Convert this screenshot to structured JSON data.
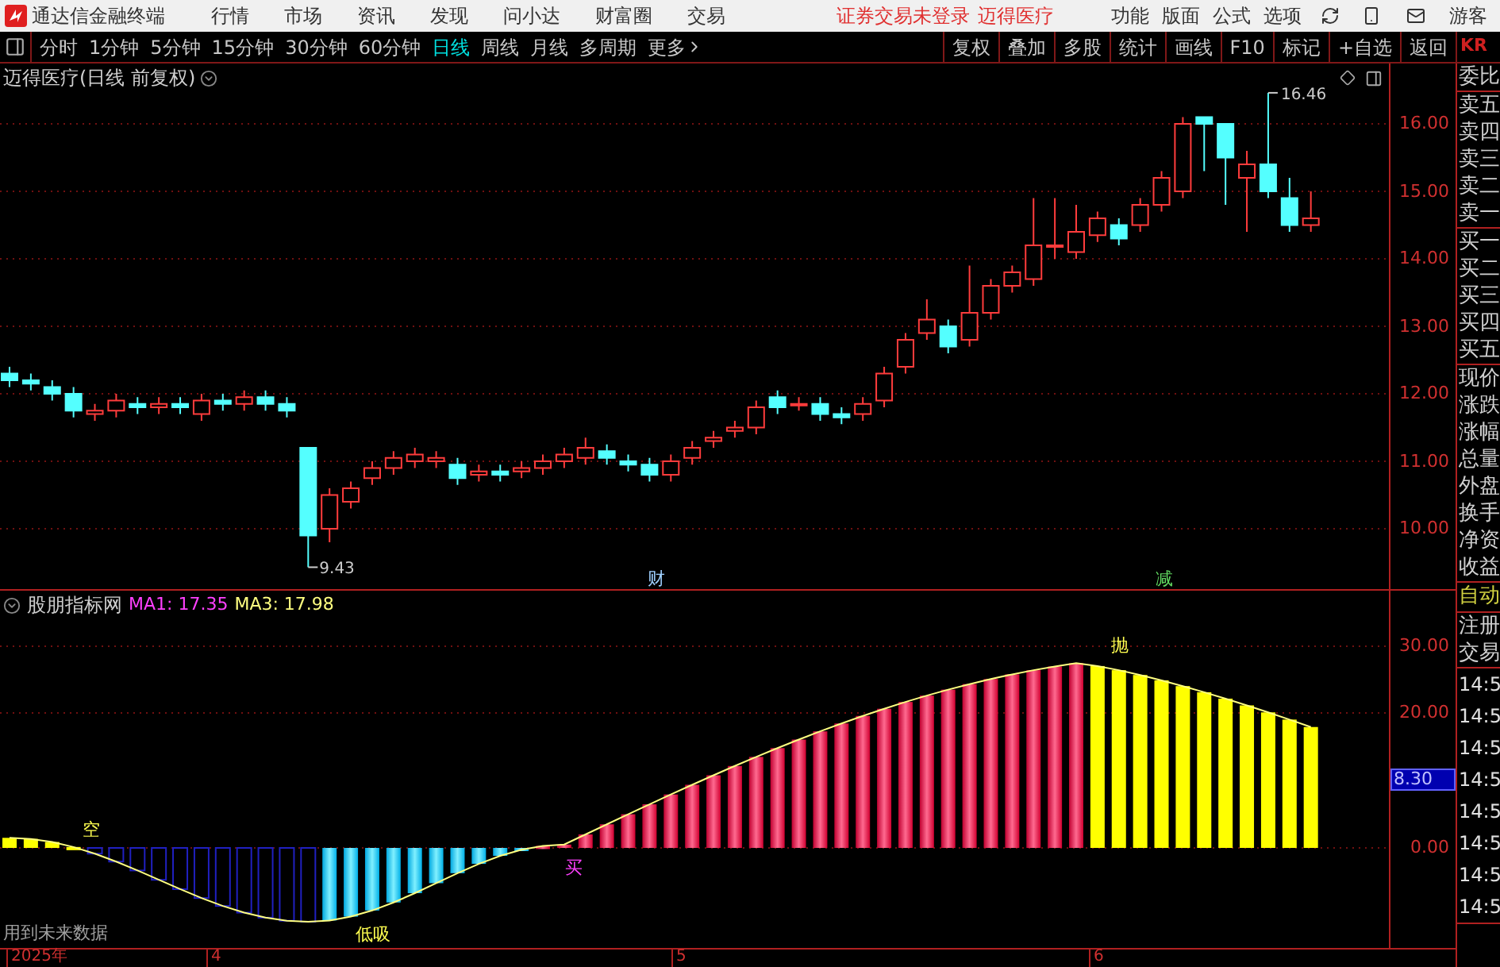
{
  "menu_bar": {
    "app_title": "通达信金融终端",
    "menus": [
      "行情",
      "市场",
      "资讯",
      "发现",
      "问小达",
      "财富圈",
      "交易"
    ],
    "notices": [
      "证券交易未登录",
      "迈得医疗"
    ],
    "functions": [
      "功能",
      "版面",
      "公式",
      "选项"
    ],
    "user": "游客"
  },
  "period_tabs": [
    {
      "label": "分时",
      "selected": false
    },
    {
      "label": "1分钟",
      "selected": false
    },
    {
      "label": "5分钟",
      "selected": false
    },
    {
      "label": "15分钟",
      "selected": false
    },
    {
      "label": "30分钟",
      "selected": false
    },
    {
      "label": "60分钟",
      "selected": false
    },
    {
      "label": "日线",
      "selected": true
    },
    {
      "label": "周线",
      "selected": false
    },
    {
      "label": "月线",
      "selected": false
    },
    {
      "label": "多周期",
      "selected": false
    },
    {
      "label": "更多",
      "selected": false
    }
  ],
  "tool_buttons": [
    "复权",
    "叠加",
    "多股",
    "统计",
    "画线",
    "F10",
    "标记",
    "+自选",
    "返回"
  ],
  "price_chart": {
    "title": "迈得医疗(日线 前复权)",
    "y_ticks": [
      "16.00",
      "15.00",
      "14.00",
      "13.00",
      "12.00",
      "11.00",
      "10.00"
    ],
    "low_label": "9.43",
    "high_label": "16.46",
    "markers": [
      {
        "text": "财",
        "color": "#9fd0ff"
      },
      {
        "text": "减",
        "color": "#60d860"
      }
    ]
  },
  "indicator": {
    "name": "股朋指标网",
    "values": [
      {
        "text": "MA1: 17.35",
        "color": "#ff40ff"
      },
      {
        "text": "MA3: 17.98",
        "color": "#ffff80"
      }
    ],
    "y_ticks": [
      "30.00",
      "20.00",
      "0.00"
    ],
    "current_value": "8.30",
    "signals": [
      {
        "text": "空",
        "color": "#ffff50"
      },
      {
        "text": "低吸",
        "color": "#ffff50"
      },
      {
        "text": "买",
        "color": "#ff40ff"
      },
      {
        "text": "抛",
        "color": "#ffff50"
      }
    ],
    "note": "用到未来数据"
  },
  "x_axis": [
    "2025年",
    "4",
    "5",
    "6"
  ],
  "side_panel": {
    "code": "KR",
    "groups": [
      {
        "kind": "label",
        "items": [
          "委比"
        ]
      },
      {
        "kind": "label",
        "items": [
          "卖五",
          "卖四",
          "卖三",
          "卖二",
          "卖一"
        ]
      },
      {
        "kind": "label",
        "items": [
          "买一",
          "买二",
          "买三",
          "买四",
          "买五"
        ]
      },
      {
        "kind": "label",
        "items": [
          "现价",
          "涨跌",
          "涨幅",
          "总量",
          "外盘",
          "换手",
          "净资",
          "收益"
        ]
      },
      {
        "kind": "mode",
        "items": [
          "自动"
        ]
      },
      {
        "kind": "label",
        "items": [
          "注册",
          "交易"
        ]
      },
      {
        "kind": "time",
        "items": [
          "14:5",
          "14:5",
          "14:5",
          "14:5",
          "14:5",
          "14:5",
          "14:5",
          "14:5"
        ]
      }
    ]
  }
}
